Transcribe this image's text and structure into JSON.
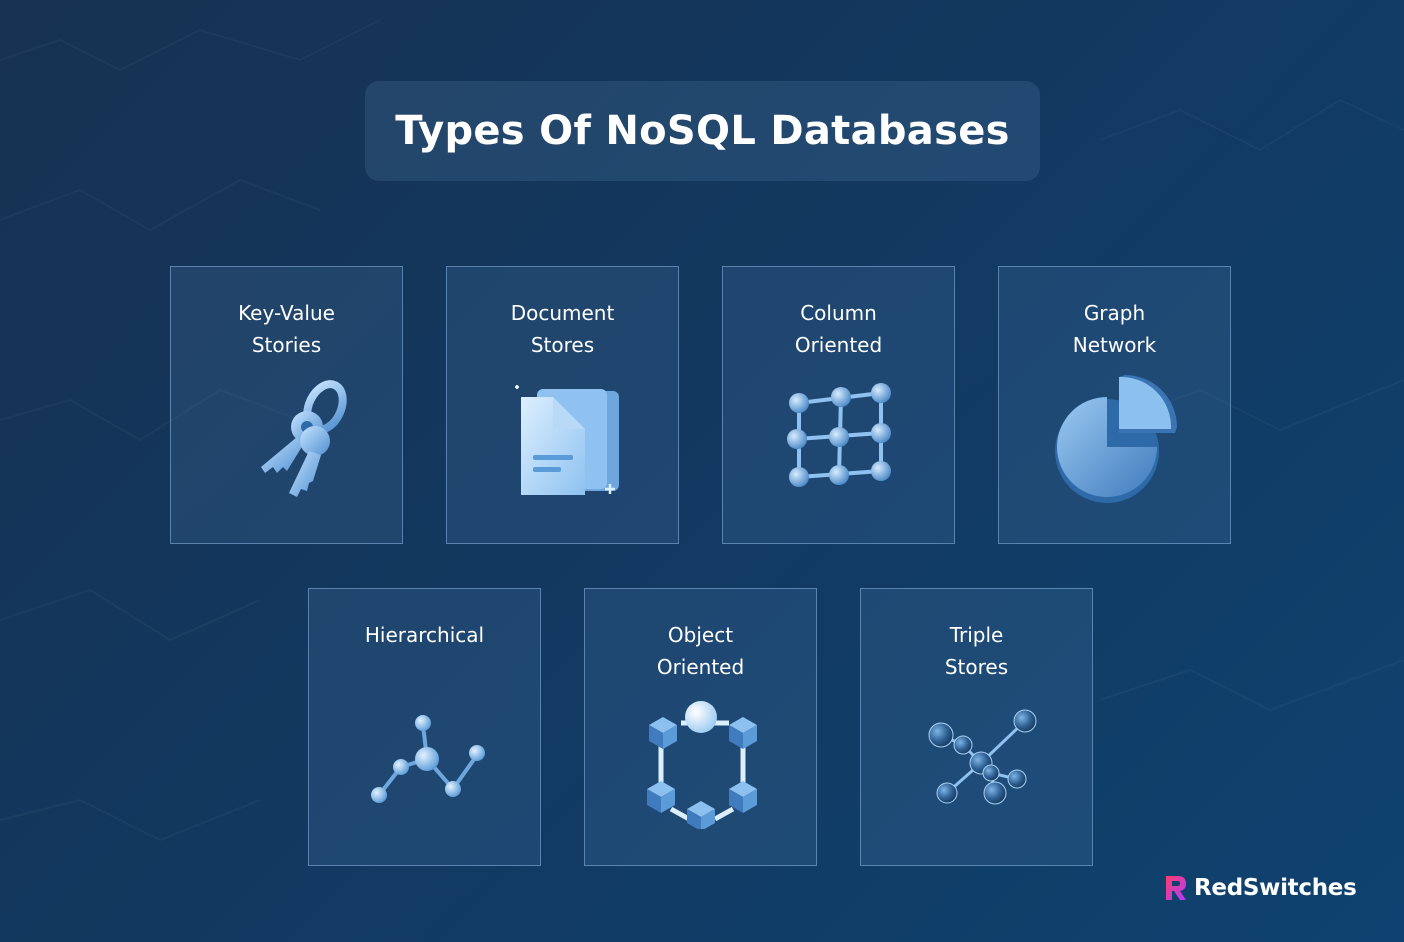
{
  "title": "Types Of NoSQL Databases",
  "cards": [
    {
      "line1": "Key-Value",
      "line2": "Stories",
      "icon": "keys-icon"
    },
    {
      "line1": "Document",
      "line2": "Stores",
      "icon": "document-icon"
    },
    {
      "line1": "Column",
      "line2": "Oriented",
      "icon": "grid-nodes-icon"
    },
    {
      "line1": "Graph",
      "line2": "Network",
      "icon": "pie-chart-icon"
    },
    {
      "line1": "Hierarchical",
      "line2": "",
      "icon": "molecule-icon"
    },
    {
      "line1": "Object",
      "line2": "Oriented",
      "icon": "cube-ring-icon"
    },
    {
      "line1": "Triple",
      "line2": "Stores",
      "icon": "sphere-network-icon"
    }
  ],
  "brand": {
    "name": "RedSwitches",
    "logo": "redswitches-logo"
  },
  "colors": {
    "background": "#12385f",
    "card_border": "#8cb4e1",
    "icon_light": "#bfe0ff",
    "icon_mid": "#5a9bd8",
    "icon_dark": "#2f6aa8"
  }
}
